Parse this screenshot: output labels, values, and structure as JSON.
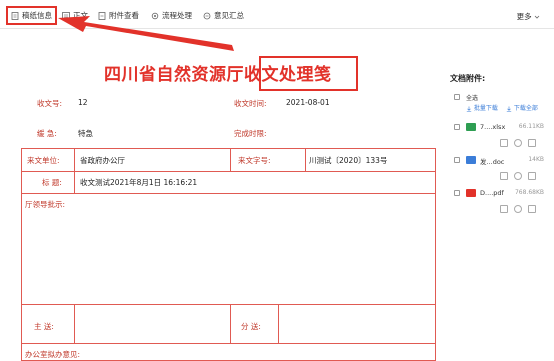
{
  "tabs": [
    {
      "label": "稿纸信息"
    },
    {
      "label": "正文"
    },
    {
      "label": "附件查看"
    },
    {
      "label": "流程处理"
    },
    {
      "label": "意见汇总"
    }
  ],
  "more_label": "更多",
  "document": {
    "title": "四川省自然资源厅收文处理笺",
    "fields": {
      "receipt_no_label": "收文号:",
      "receipt_no": "12",
      "receipt_time_label": "收文时间:",
      "receipt_time": "2021-08-01",
      "urgency_label": "缓 急:",
      "urgency": "特急",
      "deadline_label": "完成时限:",
      "deadline": ""
    },
    "table": {
      "source_unit_label": "来文单位:",
      "source_unit": "省政府办公厅",
      "doc_no_label": "来文字号:",
      "doc_no": "川测试〔2020〕133号",
      "subject_label": "标 题:",
      "subject": "收文测试2021年8月1日 16:16:21",
      "leader_label": "厅领导批示:",
      "main_send_label": "主 送:",
      "cc_label": "分 送:",
      "office_label": "办公室拟办意见:"
    }
  },
  "attachments": {
    "title": "文档附件:",
    "select_all": "全选",
    "batch_download": "批量下载",
    "download_all": "下载全部",
    "files": [
      {
        "name": "7....xlsx",
        "size": "66.11KB",
        "icon_color": "#2e9e52"
      },
      {
        "name": "发...doc",
        "size": "14KB",
        "icon_color": "#3b7dd8"
      },
      {
        "name": "D....pdf",
        "size": "768.68KB",
        "icon_color": "#e2322a"
      }
    ]
  }
}
